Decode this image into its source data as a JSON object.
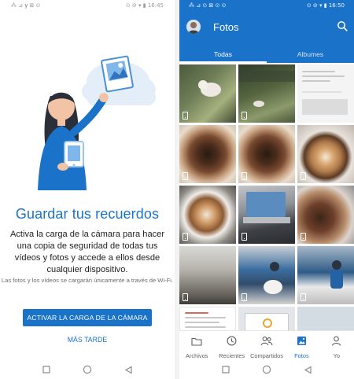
{
  "left_screen": {
    "statusbar": {
      "left": "⁂ ⊿ 𝐲 ⊠ ⊙",
      "right": "⊙ ⊘ ▾ ▮ 16:45"
    },
    "headline": "Guardar tus recuerdos",
    "description": "Activa la carga de la cámara para hacer una copia de seguridad de todas tus vídeos y fotos y accede a ellos desde cualquier dispositivo.",
    "note": "Las fotos y los vídeos se cargarán únicamente a través de Wi-Fi.",
    "primary_button": "ACTIVAR LA CARGA DE LA CÁMARA",
    "secondary_button": "MÁS TARDE"
  },
  "right_screen": {
    "statusbar": {
      "left": "⁂ ⊿ ⊙ ⊠ ⊙ ⊙",
      "right": "⊙ ⊘ ▾ ▮ 16:50"
    },
    "title": "Fotos",
    "tabs": [
      {
        "label": "Todas",
        "active": true
      },
      {
        "label": "Albumes",
        "active": false
      }
    ],
    "grid_tiles": [
      {
        "kind": "video",
        "subject": "dog-on-grass"
      },
      {
        "kind": "video",
        "subject": "dog-on-grass"
      },
      {
        "kind": "photo",
        "subject": "screenshot-chat"
      },
      {
        "kind": "video",
        "subject": "chocolate-donut"
      },
      {
        "kind": "video",
        "subject": "chocolate-donut"
      },
      {
        "kind": "video",
        "subject": "latte-art"
      },
      {
        "kind": "video",
        "subject": "latte-art"
      },
      {
        "kind": "video",
        "subject": "laptop"
      },
      {
        "kind": "video",
        "subject": "donut-on-plate"
      },
      {
        "kind": "video",
        "subject": "hallway"
      },
      {
        "kind": "video",
        "subject": "person-with-dog"
      },
      {
        "kind": "video",
        "subject": "person-with-dog"
      },
      {
        "kind": "photo",
        "subject": "document-list"
      },
      {
        "kind": "photo",
        "subject": "app-card"
      },
      {
        "kind": "photo",
        "subject": "blank"
      }
    ],
    "bottom_nav": [
      {
        "label": "Archivos",
        "icon": "folder-icon",
        "active": false
      },
      {
        "label": "Recientes",
        "icon": "clock-icon",
        "active": false
      },
      {
        "label": "Compartidos",
        "icon": "people-icon",
        "active": false
      },
      {
        "label": "Fotos",
        "icon": "photo-icon",
        "active": true
      },
      {
        "label": "Yo",
        "icon": "person-icon",
        "active": false
      }
    ]
  },
  "colors": {
    "brand_blue": "#1a73c9",
    "text_dark": "#1f1f1f",
    "text_muted": "#6d6d6d"
  }
}
